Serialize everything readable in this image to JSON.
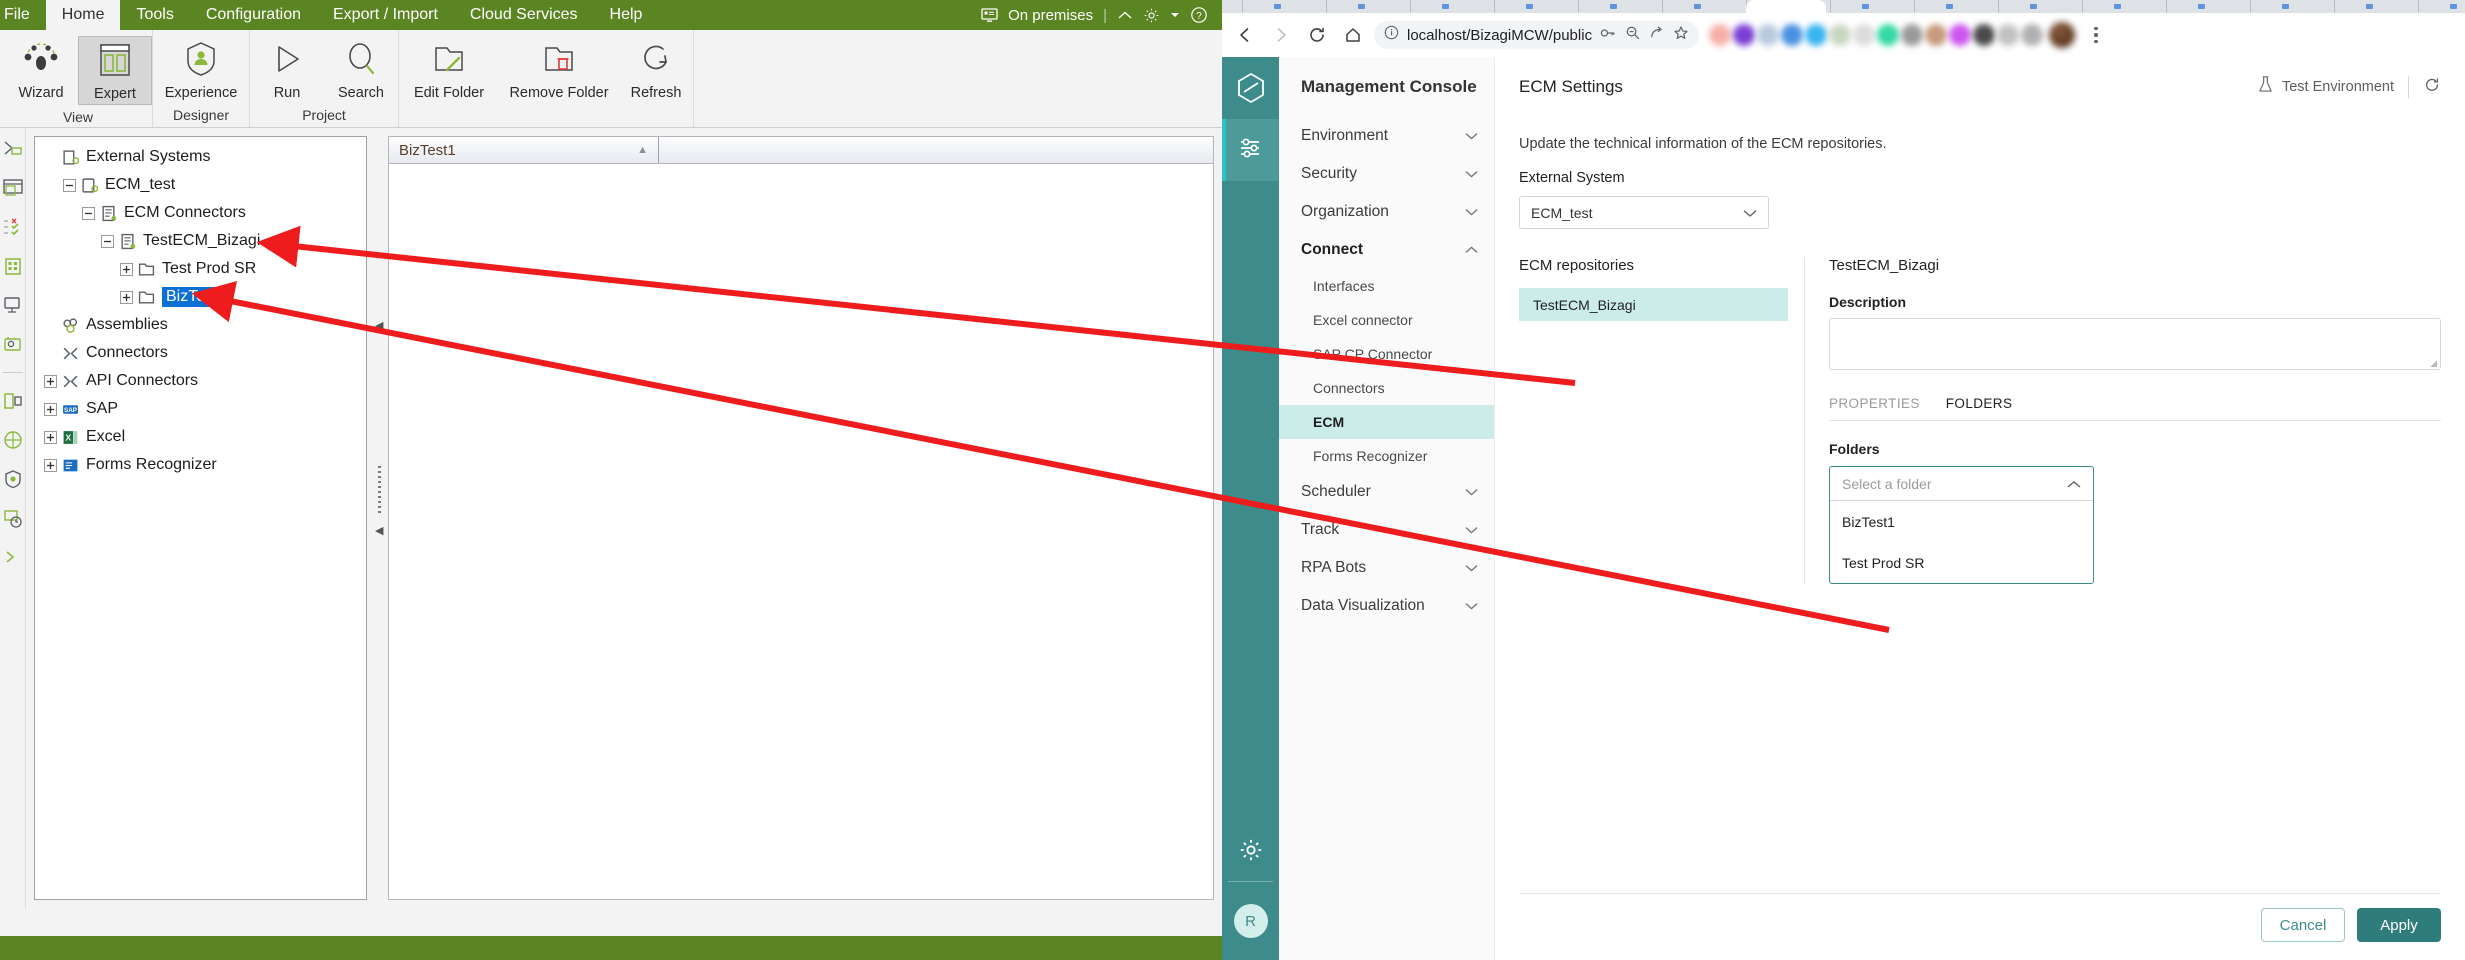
{
  "bizagi": {
    "menubar": {
      "items": [
        {
          "label": "File",
          "active": false
        },
        {
          "label": "Home",
          "active": true
        },
        {
          "label": "Tools",
          "active": false
        },
        {
          "label": "Configuration",
          "active": false
        },
        {
          "label": "Export / Import",
          "active": false
        },
        {
          "label": "Cloud Services",
          "active": false
        },
        {
          "label": "Help",
          "active": false
        }
      ],
      "status_label": "On premises",
      "separator": "|",
      "icons": [
        "monitor-icon",
        "chevron-up-icon",
        "gear-icon",
        "caret-down-icon",
        "help-circle-icon"
      ]
    },
    "ribbon": {
      "groups": [
        {
          "name": "View",
          "buttons": [
            {
              "label": "Wizard",
              "icon": "wizard-icon",
              "selected": false
            },
            {
              "label": "Expert",
              "icon": "expert-layout-icon",
              "selected": true
            }
          ]
        },
        {
          "name": "Designer",
          "buttons": [
            {
              "label": "Experience",
              "icon": "experience-person-icon",
              "selected": false
            }
          ]
        },
        {
          "name": "Project",
          "buttons": [
            {
              "label": "Run",
              "icon": "play-icon",
              "selected": false
            },
            {
              "label": "Search",
              "icon": "search-icon",
              "selected": false
            }
          ]
        },
        {
          "name": "",
          "buttons": [
            {
              "label": "Edit Folder",
              "icon": "edit-folder-icon",
              "selected": false
            },
            {
              "label": "Remove Folder",
              "icon": "remove-folder-icon",
              "selected": false
            },
            {
              "label": "Refresh",
              "icon": "refresh-icon",
              "selected": false
            }
          ]
        }
      ]
    },
    "rail_icons": [
      "processes-icon",
      "forms-icon",
      "business-rules-icon",
      "organization-icon",
      "interfaces-icon",
      "user-icon",
      "documents-icon",
      "web-icon",
      "security-icon",
      "scheduler-icon",
      "more-icon"
    ],
    "tree": [
      {
        "label": "External Systems",
        "depth": 0,
        "expander": "none",
        "icon": "external-systems-icon",
        "selected": false
      },
      {
        "label": "ECM_test",
        "depth": 1,
        "expander": "minus",
        "icon": "system-icon",
        "selected": false
      },
      {
        "label": "ECM Connectors",
        "depth": 2,
        "expander": "minus",
        "icon": "connector-group-icon",
        "selected": false
      },
      {
        "label": "TestECM_Bizagi",
        "depth": 3,
        "expander": "minus",
        "icon": "connector-group-icon",
        "selected": false
      },
      {
        "label": "Test Prod SR",
        "depth": 4,
        "expander": "plus",
        "icon": "folder-icon",
        "selected": false
      },
      {
        "label": "BizTest1",
        "depth": 4,
        "expander": "plus",
        "icon": "folder-icon",
        "selected": true
      },
      {
        "label": "Assemblies",
        "depth": 0,
        "expander": "none",
        "icon": "assemblies-icon",
        "selected": false
      },
      {
        "label": "Connectors",
        "depth": 0,
        "expander": "none",
        "icon": "connectors-icon",
        "selected": false
      },
      {
        "label": "API Connectors",
        "depth": 0,
        "expander": "plus",
        "icon": "connectors-icon",
        "selected": false
      },
      {
        "label": "SAP",
        "depth": 0,
        "expander": "plus",
        "icon": "sap-icon",
        "selected": false
      },
      {
        "label": "Excel",
        "depth": 0,
        "expander": "plus",
        "icon": "excel-icon",
        "selected": false
      },
      {
        "label": "Forms Recognizer",
        "depth": 0,
        "expander": "plus",
        "icon": "forms-recognizer-icon",
        "selected": false
      }
    ],
    "document_tab": {
      "label": "BizTest1"
    },
    "colors": {
      "brand_green": "#5b8423",
      "selection_blue": "#0b6fd4"
    }
  },
  "browser": {
    "url": "localhost/BizagiMCW/public/...",
    "nav": {
      "back": "back-arrow-icon",
      "forward": "forward-arrow-icon",
      "reload": "reload-icon",
      "home": "home-icon"
    },
    "omnibox_icons": [
      "info-circle-icon",
      "key-icon",
      "zoom-out-icon",
      "share-icon",
      "bookmark-star-icon"
    ],
    "extension_colors": [
      "#f6b0a8",
      "#7b3fd4",
      "#b9cbe0",
      "#4a90e2",
      "#39b5f0",
      "#c9d6c2",
      "#dcdcdc",
      "#34d9a5",
      "#9a9a9a",
      "#c79a7c",
      "#cc55ee",
      "#4a4a4a",
      "#c2c2c2",
      "#b0b0b0"
    ],
    "kebab": "kebab-menu-icon"
  },
  "console": {
    "title": "Management Console",
    "rail": {
      "logo": "bizagi-hex-logo-icon",
      "settings_icon": "sliders-icon",
      "gear_icon": "gear-icon",
      "avatar_initial": "R"
    },
    "menu": [
      {
        "label": "Environment",
        "type": "group",
        "open": false,
        "chevron": "chevron-down-icon"
      },
      {
        "label": "Security",
        "type": "group",
        "open": false,
        "chevron": "chevron-down-icon"
      },
      {
        "label": "Organization",
        "type": "group",
        "open": false,
        "chevron": "chevron-down-icon"
      },
      {
        "label": "Connect",
        "type": "group",
        "open": true,
        "chevron": "chevron-up-icon"
      },
      {
        "label": "Interfaces",
        "type": "sub",
        "active": false
      },
      {
        "label": "Excel connector",
        "type": "sub",
        "active": false
      },
      {
        "label": "SAP CP Connector",
        "type": "sub",
        "active": false
      },
      {
        "label": "Connectors",
        "type": "sub",
        "active": false
      },
      {
        "label": "ECM",
        "type": "sub",
        "active": true
      },
      {
        "label": "Forms Recognizer",
        "type": "sub",
        "active": false
      },
      {
        "label": "Scheduler",
        "type": "group",
        "open": false,
        "chevron": "chevron-down-icon"
      },
      {
        "label": "Track",
        "type": "group",
        "open": false,
        "chevron": "chevron-down-icon"
      },
      {
        "label": "RPA Bots",
        "type": "group",
        "open": false,
        "chevron": "chevron-down-icon"
      },
      {
        "label": "Data Visualization",
        "type": "group",
        "open": false,
        "chevron": "chevron-down-icon"
      }
    ],
    "header": {
      "page_title": "ECM Settings",
      "environment_label": "Test Environment",
      "environment_icon": "flask-icon",
      "refresh_icon": "refresh-icon"
    },
    "description": "Update the technical information of the ECM repositories.",
    "external_system": {
      "label": "External System",
      "value": "ECM_test",
      "chevron": "chevron-down-icon"
    },
    "repositories": {
      "label": "ECM repositories",
      "items": [
        {
          "label": "TestECM_Bizagi",
          "selected": true
        }
      ]
    },
    "detail": {
      "title": "TestECM_Bizagi",
      "description_label": "Description",
      "description_value": "",
      "tabs": [
        {
          "label": "PROPERTIES",
          "active": false
        },
        {
          "label": "FOLDERS",
          "active": true
        }
      ],
      "folders": {
        "label": "Folders",
        "placeholder": "Select a folder",
        "chevron": "chevron-up-icon",
        "options": [
          "BizTest1",
          "Test Prod SR"
        ]
      }
    },
    "footer": {
      "cancel_label": "Cancel",
      "apply_label": "Apply"
    },
    "colors": {
      "teal": "#3d8b8b",
      "teal_active": "#4d9a9a",
      "accent_cyan": "#2fc1c9",
      "highlight": "#ccecea",
      "apply_button": "#2f7c7c"
    }
  },
  "annotations": {
    "arrow_color": "#ee1c1c",
    "arrows": [
      {
        "from": "TestECM_Bizagi repository item",
        "to": "TestECM_Bizagi tree node"
      },
      {
        "from": "BizTest1 folder option",
        "to": "BizTest1 tree node"
      }
    ]
  }
}
